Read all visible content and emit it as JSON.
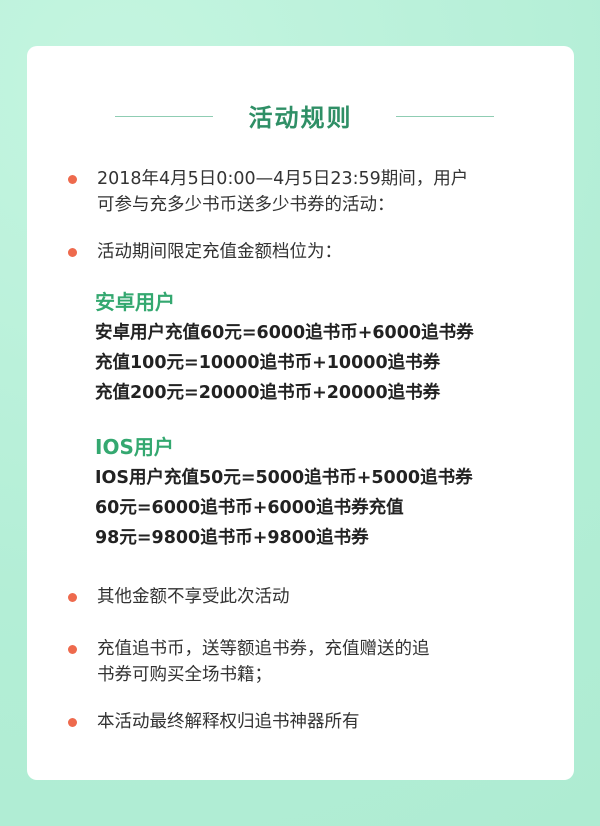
{
  "title": "活动规则",
  "rules": [
    "2018年4月5日0:00—4月5日23:59期间，用户可参与充多少书币送多少书券的活动：",
    "活动期间限定充值金额档位为：",
    "其他金额不享受此次活动",
    "充值追书币，送等额追书券，充值赠送的追书券可购买全场书籍；",
    "本活动最终解释权归追书神器所有"
  ],
  "rule1_lines": [
    "2018年4月5日0:00—4月5日23:59期间，用户",
    "可参与充多少书币送多少书券的活动："
  ],
  "rule4_lines": [
    "充值追书币，送等额追书券，充值赠送的追",
    "书券可购买全场书籍；"
  ],
  "android": {
    "heading": "安卓用户",
    "lines": [
      "安卓用户充值60元=6000追书币+6000追书券",
      "充值100元=10000追书币+10000追书券",
      "充值200元=20000追书币+20000追书券"
    ]
  },
  "ios": {
    "heading": "IOS用户",
    "lines": [
      "IOS用户充值50元=5000追书币+5000追书券",
      "60元=6000追书币+6000追书券充值",
      "98元=9800追书币+9800追书券"
    ]
  },
  "colors": {
    "background": "#b6f0d8",
    "title": "#2f8f66",
    "subhead": "#34a870",
    "bullet": "#ee6a4d"
  }
}
